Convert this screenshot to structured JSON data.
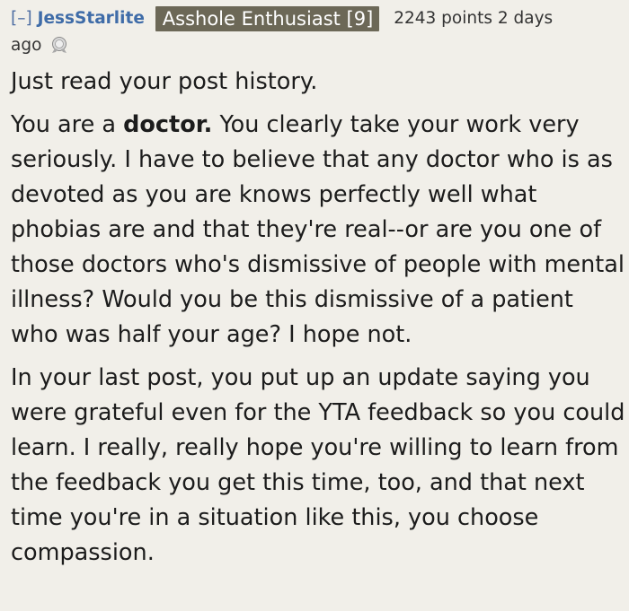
{
  "comment": {
    "collapse_label": "[–]",
    "username": "JessStarlite",
    "flair": "Asshole Enthusiast [9]",
    "meta_line1": "2243 points 2 days",
    "meta_line2": "ago",
    "award_icon": "silver-award-icon",
    "paragraphs": {
      "p1": "Just read your post history.",
      "p2_before": "You are a ",
      "p2_bold": "doctor.",
      "p2_after": " You clearly take your work very seriously. I have to believe that any doctor who is as devoted as you are knows perfectly well what phobias are and that they're real--or are you one of those doctors who's dismissive of people with mental illness? Would you be this dismissive of a patient who was half your age? I hope not.",
      "p3": "In your last post, you put up an update saying you were grateful even for the YTA feedback so you could learn. I really, really hope you're willing to learn from the feedback you get this time, too, and that next time you're in a situation like this, you choose compassion."
    }
  },
  "colors": {
    "background": "#f1efe9",
    "username": "#3f6ca8",
    "flair_bg": "#6c6857"
  }
}
